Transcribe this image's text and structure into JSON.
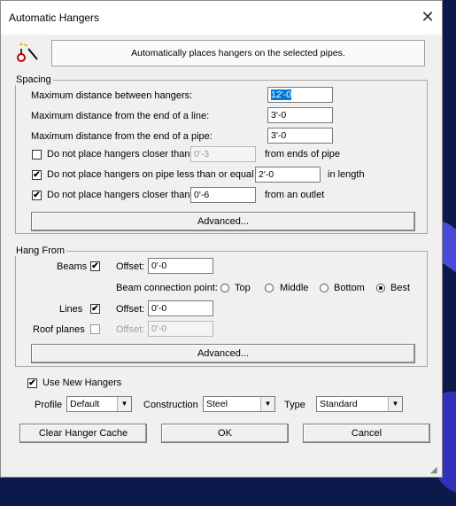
{
  "window": {
    "title": "Automatic Hangers",
    "close_glyph": "✕"
  },
  "header": {
    "description": "Automatically places hangers on the selected pipes.",
    "icon": "hanger-wand-icon"
  },
  "spacing": {
    "label": "Spacing",
    "max_between_label": "Maximum distance between hangers:",
    "max_between_value": "12'-0",
    "max_end_line_label": "Maximum distance from the end of a line:",
    "max_end_line_value": "3'-0",
    "max_end_pipe_label": "Maximum distance from the end of a pipe:",
    "max_end_pipe_value": "3'-0",
    "closer_ends_label": "Do not place hangers closer than",
    "closer_ends_value": "0'-3",
    "closer_ends_suffix": "from ends of pipe",
    "closer_ends_checked": false,
    "short_pipe_label": "Do not place hangers on pipe less than or equal to",
    "short_pipe_value": "2'-0",
    "short_pipe_suffix": "in length",
    "short_pipe_checked": true,
    "outlet_label": "Do not place hangers closer than",
    "outlet_value": "0'-6",
    "outlet_suffix": "from an outlet",
    "outlet_checked": true,
    "advanced_label": "Advanced..."
  },
  "hang_from": {
    "label": "Hang From",
    "beams_label": "Beams",
    "beams_checked": true,
    "beams_offset_label": "Offset:",
    "beams_offset_value": "0'-0",
    "beam_connection_label": "Beam connection point:",
    "connection_options": [
      "Top",
      "Middle",
      "Bottom",
      "Best"
    ],
    "connection_selected": "Best",
    "lines_label": "Lines",
    "lines_checked": true,
    "lines_offset_label": "Offset:",
    "lines_offset_value": "0'-0",
    "roof_label": "Roof planes",
    "roof_checked": false,
    "roof_offset_label": "Offset:",
    "roof_offset_value": "0'-0",
    "advanced_label": "Advanced..."
  },
  "options": {
    "use_new_hangers_label": "Use New Hangers",
    "use_new_hangers_checked": true,
    "profile_label": "Profile",
    "profile_value": "Default",
    "construction_label": "Construction",
    "construction_value": "Steel",
    "type_label": "Type",
    "type_value": "Standard"
  },
  "buttons": {
    "clear_cache": "Clear Hanger Cache",
    "ok": "OK",
    "cancel": "Cancel"
  },
  "colors": {
    "desktop": "#0b1a4a",
    "accent": "#0078d7",
    "dialog_bg": "#f0f0f0"
  }
}
